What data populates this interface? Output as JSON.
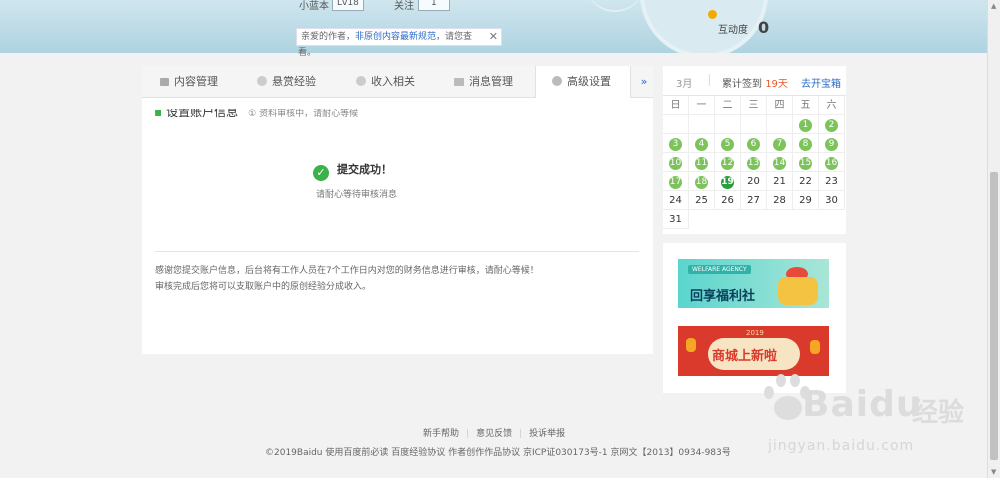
{
  "header": {
    "level_label": "小蓝本",
    "level_value": "Lv18",
    "follow_label": "关注",
    "follow_value": "1",
    "interaction_label": "互动度",
    "interaction_value": "0",
    "notice": {
      "prefix": "亲爱的作者，",
      "link": "非原创内容最新规范",
      "suffix": "，请您查",
      "wrap": "看。"
    }
  },
  "tabs": [
    {
      "label": "内容管理",
      "icon": "list-icon"
    },
    {
      "label": "悬赏经验",
      "icon": "reward-icon"
    },
    {
      "label": "收入相关",
      "icon": "income-icon"
    },
    {
      "label": "消息管理",
      "icon": "mail-icon"
    },
    {
      "label": "高级设置",
      "icon": "gear-icon",
      "active": true
    }
  ],
  "tab_more": "»",
  "section": {
    "title": "设置账户信息",
    "hint": "① 资料审核中，请耐心等候"
  },
  "success": {
    "title": "提交成功！",
    "subtitle": "请耐心等待审核消息"
  },
  "description": {
    "line1": "感谢您提交账户信息，后台将有工作人员在7个工作日内对您的财务信息进行审核，请耐心等候！",
    "line2": "审核完成后您将可以支取账户中的原创经验分成收入。"
  },
  "calendar": {
    "month": "3月",
    "streak_label": "累计签到",
    "streak_value": "19天",
    "treasure_link": "去开宝箱",
    "weekdays": [
      "日",
      "一",
      "二",
      "三",
      "四",
      "五",
      "六"
    ],
    "rows": [
      [
        "",
        "",
        "",
        "",
        "",
        "1",
        "2"
      ],
      [
        "3",
        "4",
        "5",
        "6",
        "7",
        "8",
        "9"
      ],
      [
        "10",
        "11",
        "12",
        "13",
        "14",
        "15",
        "16"
      ],
      [
        "17",
        "18",
        "19",
        "20",
        "21",
        "22",
        "23"
      ],
      [
        "24",
        "25",
        "26",
        "27",
        "28",
        "29",
        "30"
      ],
      [
        "31"
      ]
    ],
    "signed_through": 18,
    "today": 19
  },
  "promos": {
    "ad1_tag": "WELFARE AGENCY",
    "ad1_title": "回享福利社",
    "ad2_year": "2019",
    "ad2_title": "商城上新啦"
  },
  "footer": {
    "links": [
      "新手帮助",
      "意见反馈",
      "投诉举报"
    ],
    "copyright": "©2019Baidu  使用百度前必读  百度经验协议  作者创作作品协议  京ICP证030173号-1 京网文【2013】0934-983号"
  },
  "watermark": {
    "brand": "Bai",
    "brand2": "du",
    "cn": "经验",
    "url": "jingyan.baidu.com"
  },
  "colors": {
    "accent_blue": "#2d6bc4",
    "success_green": "#3bb14a",
    "signed_green": "#7cc35c",
    "streak_orange": "#e85a2c"
  }
}
